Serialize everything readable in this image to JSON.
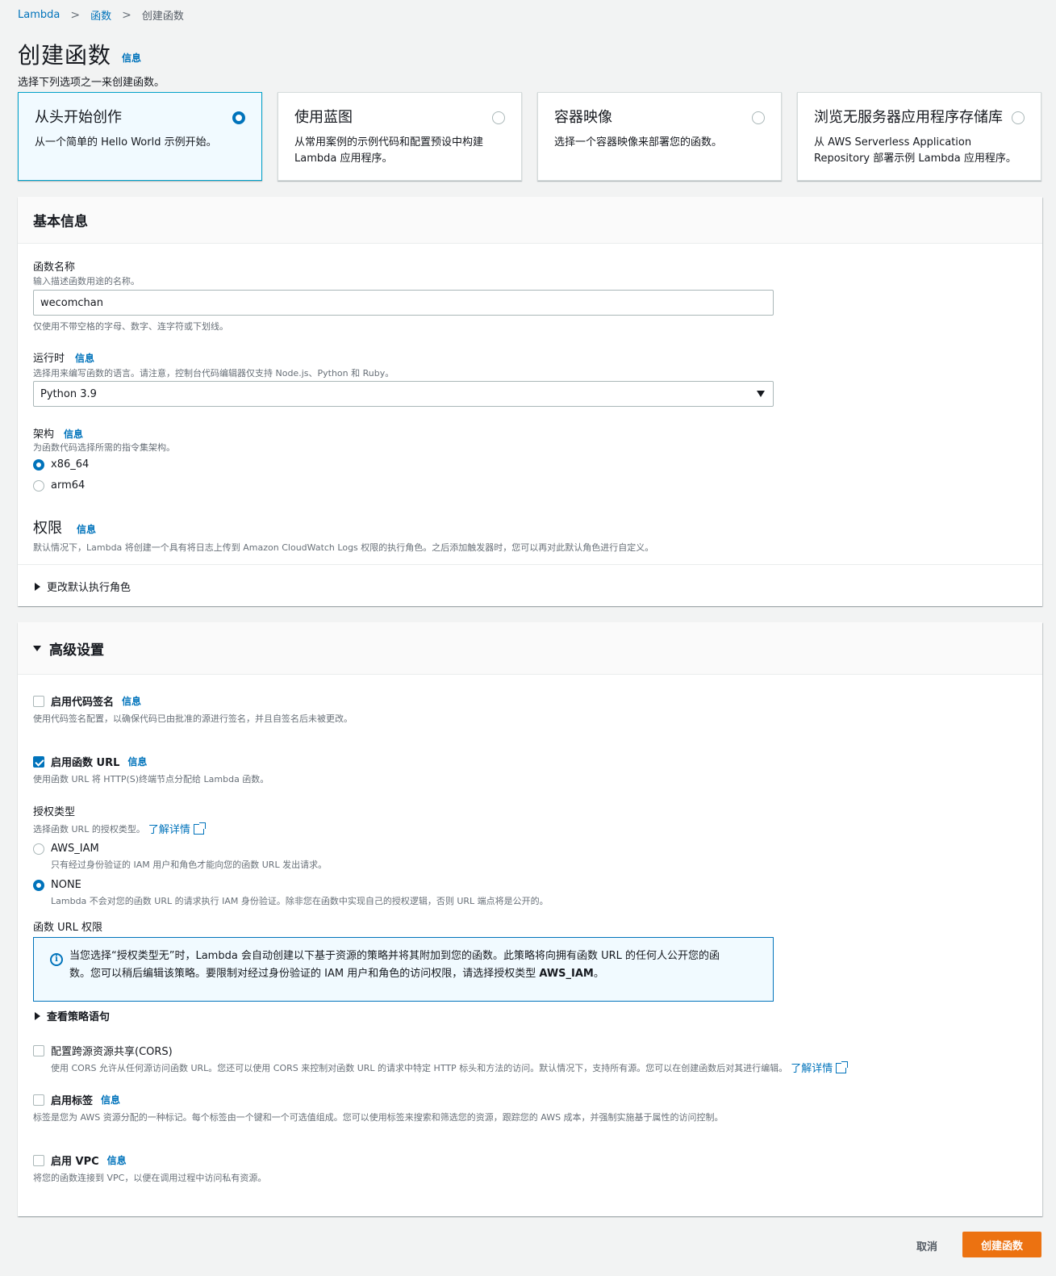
{
  "breadcrumb": {
    "items": [
      "Lambda",
      "函数"
    ],
    "current": "创建函数"
  },
  "page": {
    "title": "创建函数",
    "info": "信息",
    "subtitle": "选择下列选项之一来创建函数。"
  },
  "tiles": [
    {
      "title": "从头开始创作",
      "desc": "从一个简单的 Hello World 示例开始。",
      "selected": true
    },
    {
      "title": "使用蓝图",
      "desc": "从常用案例的示例代码和配置预设中构建 Lambda 应用程序。",
      "selected": false
    },
    {
      "title": "容器映像",
      "desc": "选择一个容器映像来部署您的函数。",
      "selected": false
    },
    {
      "title": "浏览无服务器应用程序存储库",
      "desc": "从 AWS Serverless Application Repository 部署示例 Lambda 应用程序。",
      "selected": false
    }
  ],
  "basic": {
    "header": "基本信息",
    "fname": {
      "label": "函数名称",
      "desc": "输入描述函数用途的名称。",
      "value": "wecomchan",
      "hint": "仅使用不带空格的字母、数字、连字符或下划线。"
    },
    "runtime": {
      "label": "运行时",
      "info": "信息",
      "desc": "选择用来编写函数的语言。请注意，控制台代码编辑器仅支持 Node.js、Python 和 Ruby。",
      "value": "Python 3.9"
    },
    "arch": {
      "label": "架构",
      "info": "信息",
      "desc": "为函数代码选择所需的指令集架构。",
      "options": [
        "x86_64",
        "arm64"
      ],
      "selected": "x86_64"
    },
    "perm": {
      "label": "权限",
      "info": "信息",
      "desc": "默认情况下，Lambda 将创建一个具有将日志上传到 Amazon CloudWatch Logs 权限的执行角色。之后添加触发器时，您可以再对此默认角色进行自定义。",
      "expander": "更改默认执行角色"
    }
  },
  "advanced": {
    "header": "高级设置",
    "codesign": {
      "label": "启用代码签名",
      "info": "信息",
      "desc": "使用代码签名配置，以确保代码已由批准的源进行签名，并且自签名后未被更改。",
      "checked": false
    },
    "furl": {
      "label": "启用函数 URL",
      "info": "信息",
      "desc": "使用函数 URL 将 HTTP(S)终端节点分配给 Lambda 函数。",
      "checked": true
    },
    "auth": {
      "label": "授权类型",
      "desc": "选择函数 URL 的授权类型。",
      "learn": "了解详情",
      "opt1": {
        "label": "AWS_IAM",
        "desc": "只有经过身份验证的 IAM 用户和角色才能向您的函数 URL 发出请求。"
      },
      "opt2": {
        "label": "NONE",
        "desc": "Lambda 不会对您的函数 URL 的请求执行 IAM 身份验证。除非您在函数中实现自己的授权逻辑，否则 URL 端点将是公开的。"
      },
      "selected": "NONE"
    },
    "urlperm": {
      "label": "函数 URL 权限",
      "alert_line1": "当您选择“授权类型无”时，Lambda 会自动创建以下基于资源的策略并将其附加到您的函数。此策略将向拥有函数 URL 的任何人公开您的函",
      "alert_line2": "数。您可以稍后编辑该策略。要限制对经过身份验证的 IAM 用户和角色的访问权限，请选择授权类型",
      "alert_strong": "AWS_IAM",
      "alert_end": "。",
      "expander": "查看策略语句"
    },
    "cors": {
      "label": "配置跨源资源共享(CORS)",
      "desc": "使用 CORS 允许从任何源访问函数 URL。您还可以使用 CORS 来控制对函数 URL 的请求中特定 HTTP 标头和方法的访问。默认情况下，支持所有源。您可以在创建函数后对其进行编辑。",
      "learn": "了解详情",
      "checked": false
    },
    "tags": {
      "label": "启用标签",
      "info": "信息",
      "desc": "标签是您为 AWS 资源分配的一种标记。每个标签由一个键和一个可选值组成。您可以使用标签来搜索和筛选您的资源，跟踪您的 AWS 成本，并强制实施基于属性的访问控制。",
      "checked": false
    },
    "vpc": {
      "label": "启用 VPC",
      "info": "信息",
      "desc": "将您的函数连接到 VPC，以便在调用过程中访问私有资源。",
      "checked": false
    }
  },
  "footer": {
    "cancel": "取消",
    "create": "创建函数"
  },
  "colors": {
    "accent": "#0073bb",
    "primary": "#ec7211",
    "selected_bg": "#f1faff"
  }
}
